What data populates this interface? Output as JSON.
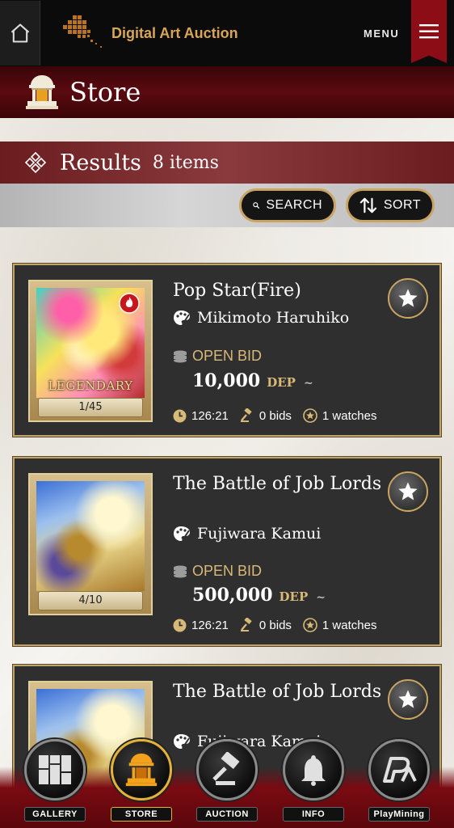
{
  "header": {
    "brand": "Digital Art Auction",
    "menu_label": "MENU"
  },
  "page": {
    "title": "Store"
  },
  "results": {
    "title": "Results",
    "count": "8 items"
  },
  "toolbar": {
    "search_label": "SEARCH",
    "sort_label": "SORT"
  },
  "cards": [
    {
      "title": "Pop Star(Fire)",
      "artist": "Mikimoto Haruhiko",
      "bid_type": "OPEN BID",
      "price": "10,000",
      "unit": "DEP",
      "tilde": "~",
      "edition": "1/45",
      "rarity": "LEGENDARY",
      "time": "126:21",
      "bids": "0 bids",
      "watches": "1 watches"
    },
    {
      "title": "The Battle of Job Lords",
      "artist": "Fujiwara Kamui",
      "bid_type": "OPEN BID",
      "price": "500,000",
      "unit": "DEP",
      "tilde": "~",
      "edition": "4/10",
      "time": "126:21",
      "bids": "0 bids",
      "watches": "1 watches"
    },
    {
      "title": "The Battle of Job Lords",
      "artist": "Fujiwara Kamui"
    }
  ],
  "nav": [
    {
      "label": "GALLERY",
      "icon": "gallery-icon"
    },
    {
      "label": "STORE",
      "icon": "store-icon",
      "active": true
    },
    {
      "label": "AUCTION",
      "icon": "gavel-icon"
    },
    {
      "label": "INFO",
      "icon": "bell-icon"
    },
    {
      "label": "PlayMining",
      "icon": "playmining-icon"
    }
  ],
  "colors": {
    "accent_gold": "#c9a462",
    "header_red": "#5a0a10",
    "brand_gold": "#d9a655",
    "card_bg": "#2f2f2f"
  }
}
